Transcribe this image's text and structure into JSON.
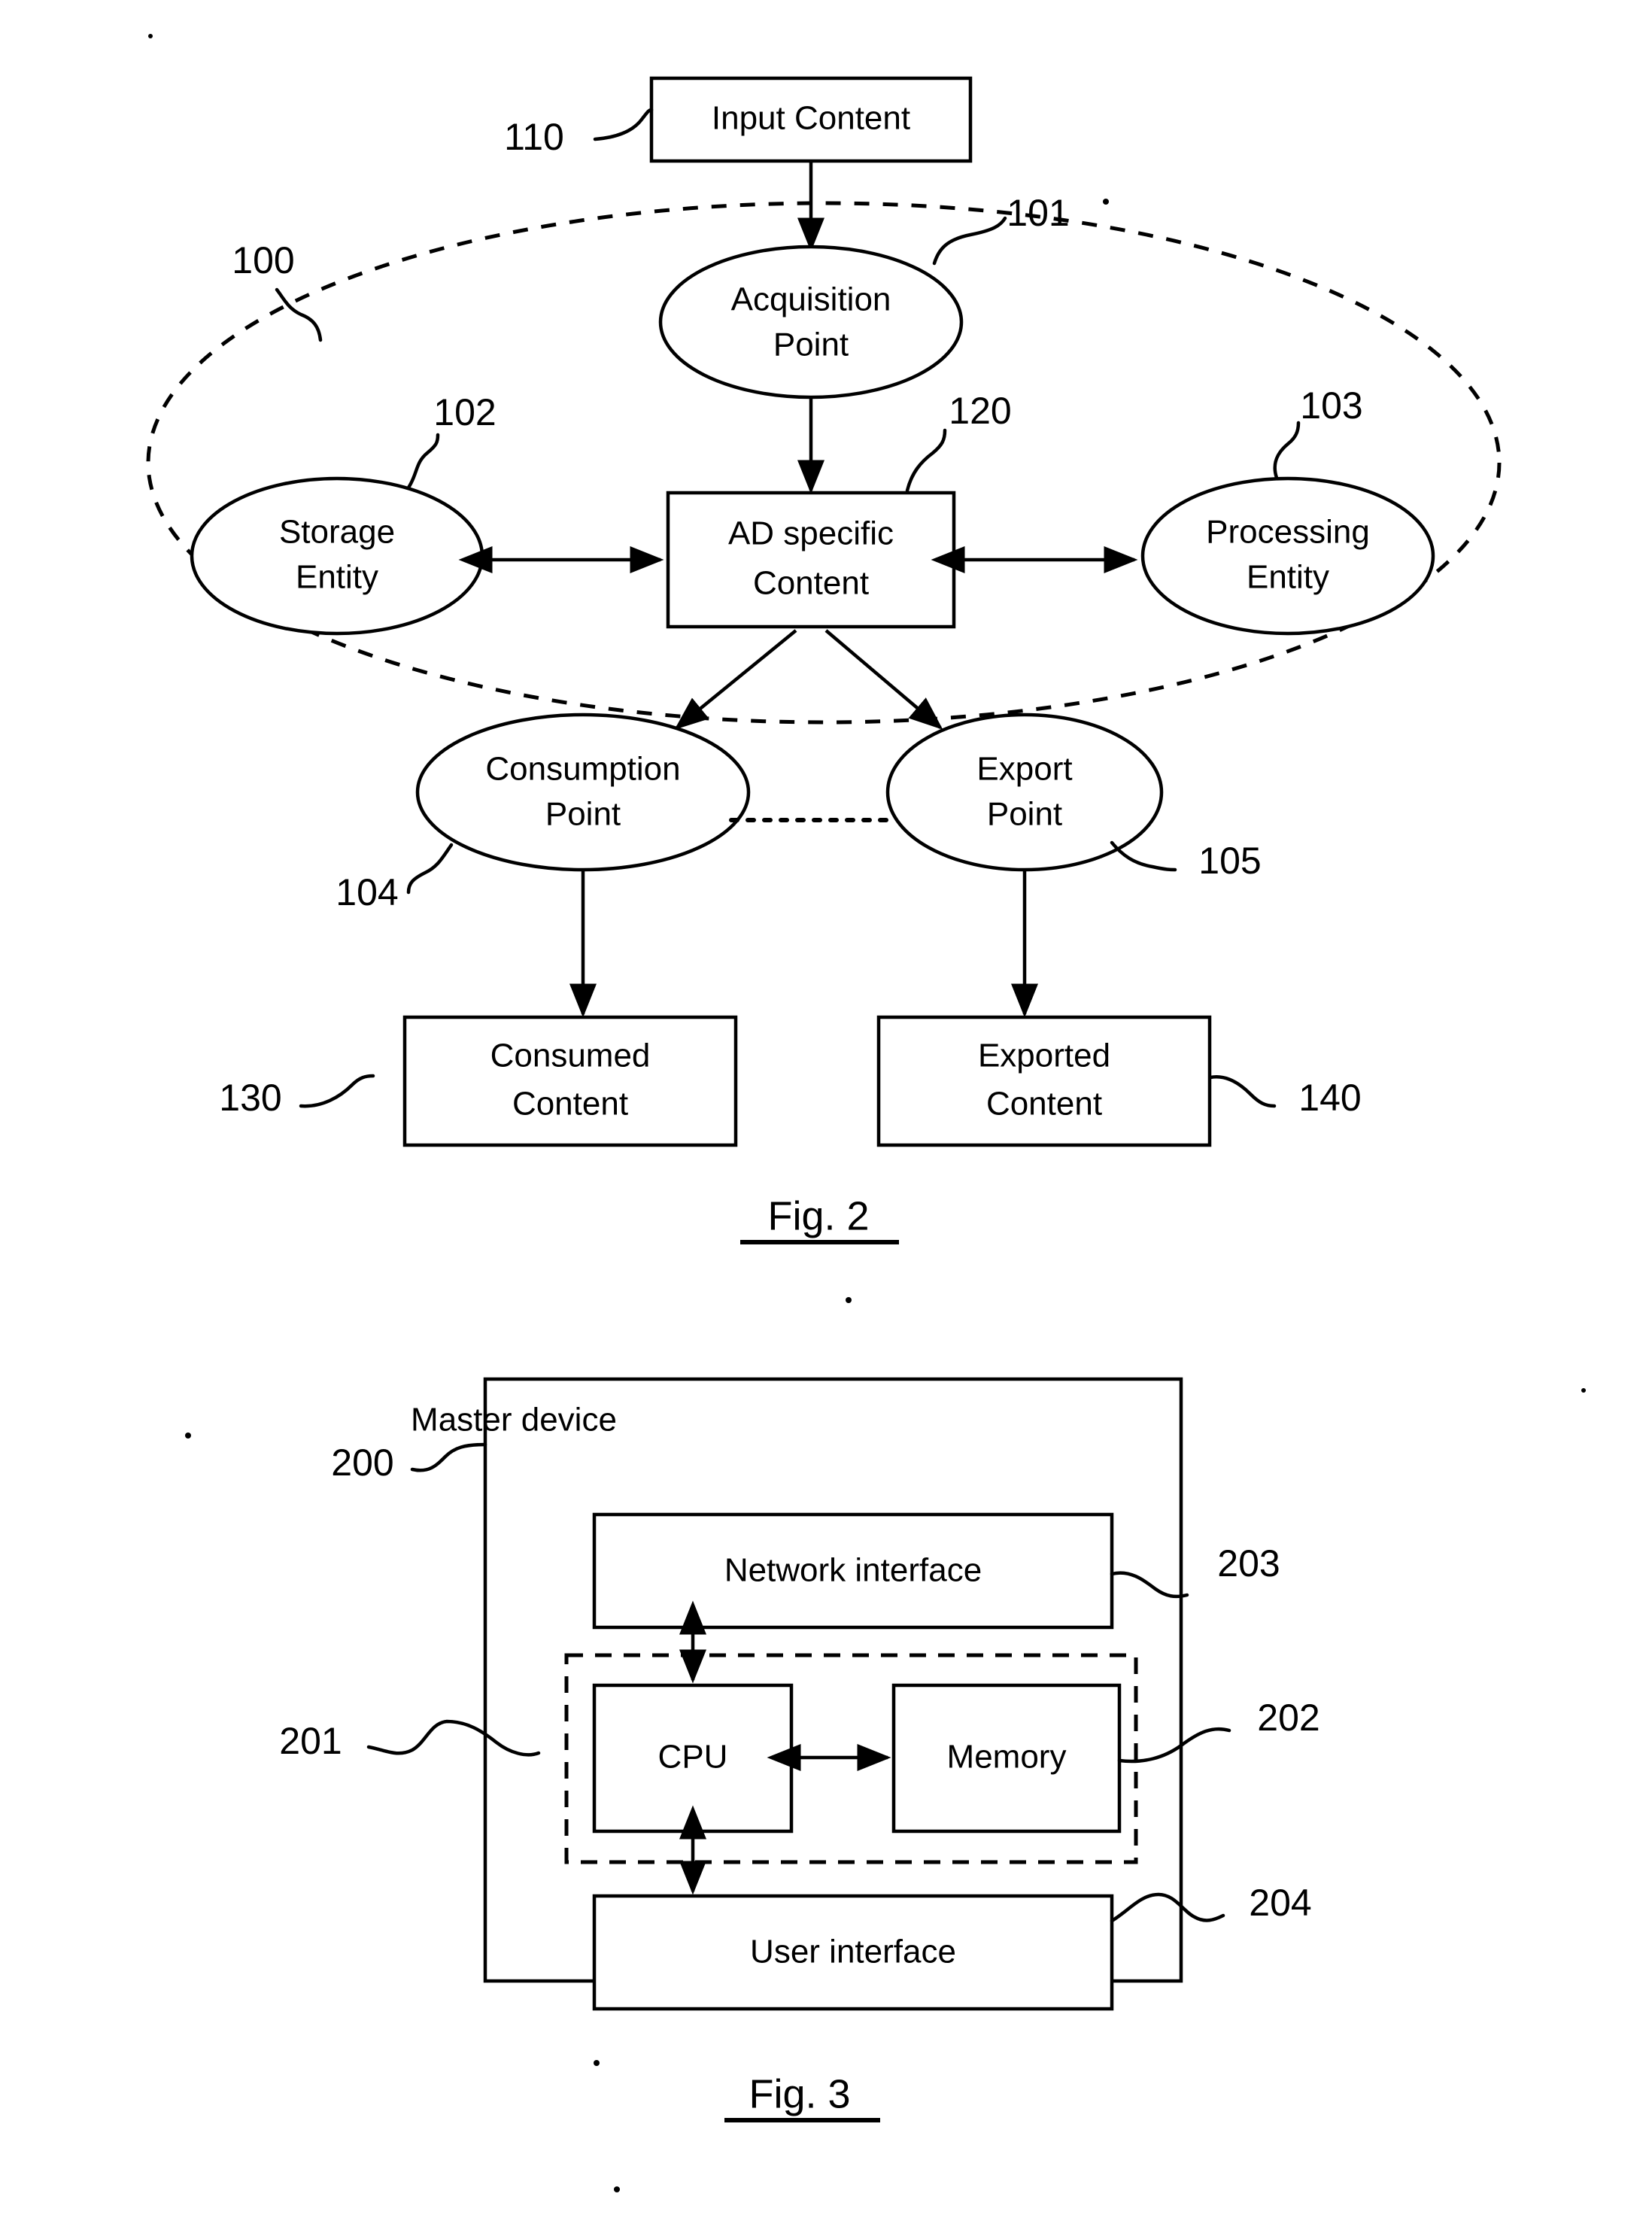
{
  "document": {
    "kind": "patent-drawing-sheet",
    "background": "#ffffff",
    "ink": "#000000"
  },
  "figure2": {
    "caption": "Fig. 2",
    "authorized_domain_ref": "100",
    "nodes": {
      "input_content": {
        "label": "Input Content",
        "ref": "110",
        "shape": "rectangle"
      },
      "acquisition_point": {
        "label_line1": "Acquisition",
        "label_line2": "Point",
        "ref": "101",
        "shape": "ellipse"
      },
      "storage_entity": {
        "label_line1": "Storage",
        "label_line2": "Entity",
        "ref": "102",
        "shape": "ellipse"
      },
      "ad_specific_content": {
        "label_line1": "AD specific",
        "label_line2": "Content",
        "ref": "120",
        "shape": "rectangle"
      },
      "processing_entity": {
        "label_line1": "Processing",
        "label_line2": "Entity",
        "ref": "103",
        "shape": "ellipse"
      },
      "consumption_point": {
        "label_line1": "Consumption",
        "label_line2": "Point",
        "ref": "104",
        "shape": "ellipse"
      },
      "export_point": {
        "label_line1": "Export",
        "label_line2": "Point",
        "ref": "105",
        "shape": "ellipse"
      },
      "consumed_content": {
        "label_line1": "Consumed",
        "label_line2": "Content",
        "ref": "130",
        "shape": "rectangle"
      },
      "exported_content": {
        "label_line1": "Exported",
        "label_line2": "Content",
        "ref": "140",
        "shape": "rectangle"
      }
    },
    "edges": [
      {
        "from": "input_content",
        "to": "acquisition_point",
        "style": "arrow"
      },
      {
        "from": "acquisition_point",
        "to": "ad_specific_content",
        "style": "arrow"
      },
      {
        "from": "storage_entity",
        "to": "ad_specific_content",
        "style": "double-arrow"
      },
      {
        "from": "ad_specific_content",
        "to": "processing_entity",
        "style": "double-arrow"
      },
      {
        "from": "ad_specific_content",
        "to": "consumption_point",
        "style": "arrow"
      },
      {
        "from": "ad_specific_content",
        "to": "export_point",
        "style": "arrow"
      },
      {
        "from": "consumption_point",
        "to": "export_point",
        "style": "dotted"
      },
      {
        "from": "consumption_point",
        "to": "consumed_content",
        "style": "arrow"
      },
      {
        "from": "export_point",
        "to": "exported_content",
        "style": "arrow"
      }
    ]
  },
  "figure3": {
    "caption": "Fig. 3",
    "nodes": {
      "master_device": {
        "label": "Master device",
        "ref": "200",
        "shape": "rectangle"
      },
      "network_interface": {
        "label": "Network interface",
        "ref": "203",
        "shape": "rectangle"
      },
      "cpu": {
        "label": "CPU",
        "ref": "201",
        "shape": "rectangle"
      },
      "memory": {
        "label": "Memory",
        "ref": "202",
        "shape": "rectangle"
      },
      "user_interface": {
        "label": "User interface",
        "ref": "204",
        "shape": "rectangle"
      },
      "cpu_memory_group": {
        "shape": "dashed-rectangle"
      }
    },
    "edges": [
      {
        "from": "network_interface",
        "to": "cpu",
        "style": "double-arrow"
      },
      {
        "from": "cpu",
        "to": "memory",
        "style": "double-arrow"
      },
      {
        "from": "cpu",
        "to": "user_interface",
        "style": "double-arrow"
      }
    ]
  }
}
